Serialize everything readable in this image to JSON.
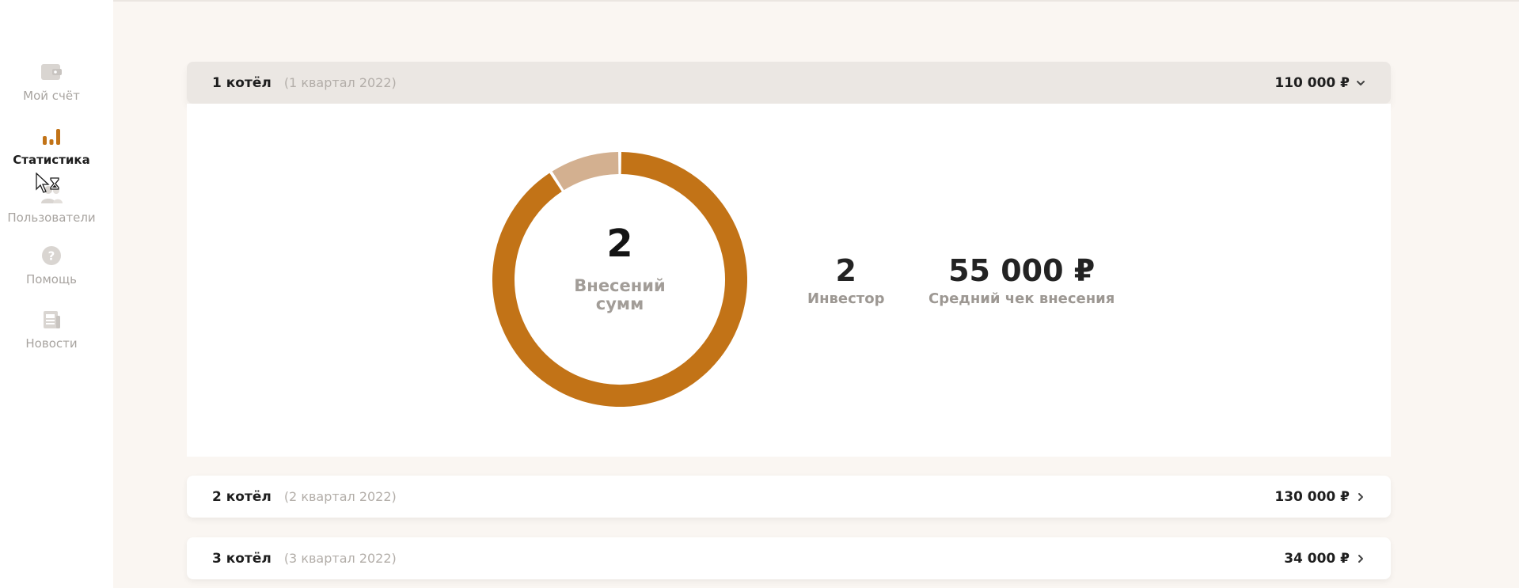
{
  "sidebar": {
    "items": [
      {
        "label": "Мой счёт",
        "icon": "wallet-icon",
        "active": false
      },
      {
        "label": "Статистика",
        "icon": "bar-chart-icon",
        "active": true
      },
      {
        "label": "Пользователи",
        "icon": "users-icon",
        "active": false
      },
      {
        "label": "Помощь",
        "icon": "question-icon",
        "active": false
      },
      {
        "label": "Новости",
        "icon": "newspaper-icon",
        "active": false
      }
    ]
  },
  "pools": [
    {
      "title": "1 котёл",
      "period": "(1 квартал 2022)",
      "amount": "110 000 ₽",
      "expanded": true
    },
    {
      "title": "2 котёл",
      "period": "(2 квартал 2022)",
      "amount": "130 000 ₽",
      "expanded": false
    },
    {
      "title": "3 котёл",
      "period": "(3 квартал 2022)",
      "amount": "34 000 ₽",
      "expanded": false
    }
  ],
  "expanded_stats": {
    "donut_value": "2",
    "donut_label": "Внесений сумм",
    "investors_value": "2",
    "investors_label": "Инвестор",
    "avg_value": "55 000 ₽",
    "avg_label": "Средний чек внесения"
  },
  "colors": {
    "accent": "#c27317",
    "accent_light": "#d3b090",
    "text_dark": "#1e1e1e",
    "muted": "#a8a4a0",
    "background": "#faf6f2"
  },
  "chart_data": {
    "type": "pie",
    "style": "donut",
    "values": [
      100000,
      10000
    ],
    "colors": [
      "#c27317",
      "#d3b090"
    ]
  }
}
